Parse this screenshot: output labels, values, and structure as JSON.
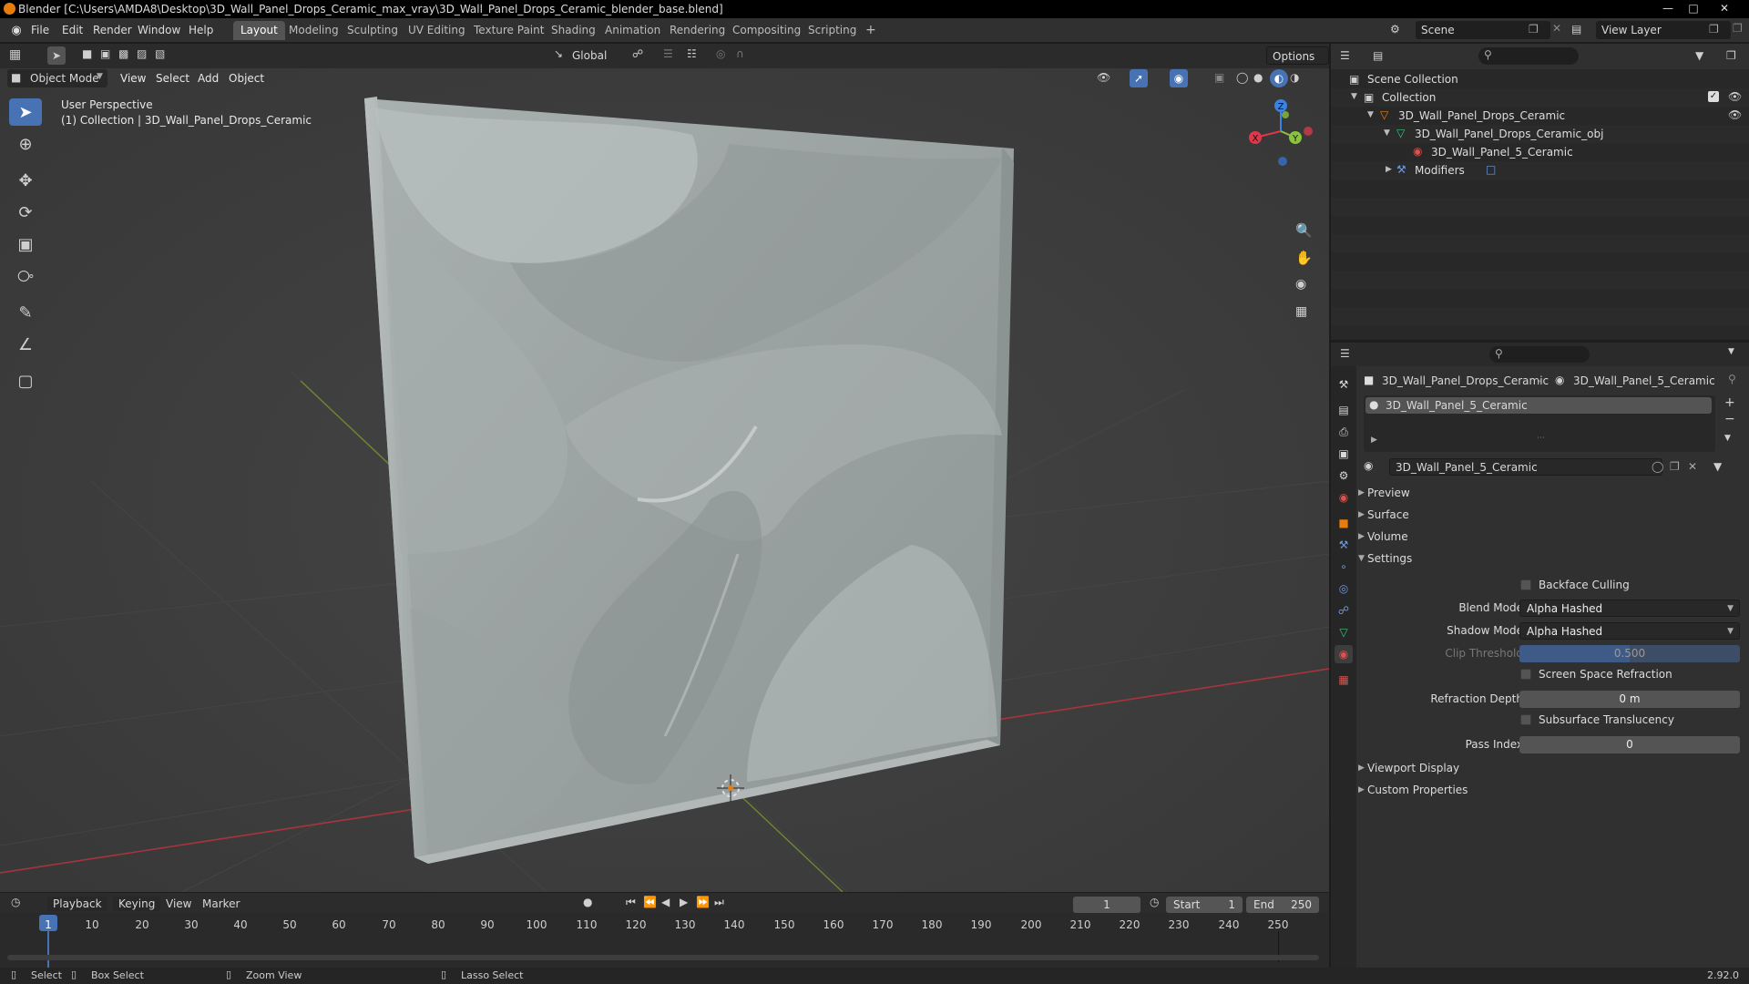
{
  "window": {
    "title": "Blender [C:\\Users\\AMDA8\\Desktop\\3D_Wall_Panel_Drops_Ceramic_max_vray\\3D_Wall_Panel_Drops_Ceramic_blender_base.blend]"
  },
  "menubar": {
    "items": [
      "File",
      "Edit",
      "Render",
      "Window",
      "Help"
    ],
    "workspaces": [
      "Layout",
      "Modeling",
      "Sculpting",
      "UV Editing",
      "Texture Paint",
      "Shading",
      "Animation",
      "Rendering",
      "Compositing",
      "Scripting"
    ],
    "active_workspace": "Layout",
    "add_tab": "+",
    "scene_label": "Scene",
    "view_layer_label": "View Layer"
  },
  "viewport": {
    "transform_orientation": "Global",
    "options_label": "Options",
    "mode": "Object Mode",
    "menus": [
      "View",
      "Select",
      "Add",
      "Object"
    ],
    "overlay_title": "User Perspective",
    "overlay_subtitle": "(1) Collection | 3D_Wall_Panel_Drops_Ceramic",
    "gizmo_axes": {
      "x": "X",
      "y": "Y",
      "z": "Z"
    }
  },
  "timeline": {
    "menus": [
      "Playback",
      "Keying",
      "View",
      "Marker"
    ],
    "current_frame": "1",
    "start_label": "Start",
    "start_value": "1",
    "end_label": "End",
    "end_value": "250",
    "ticks": [
      "1",
      "10",
      "20",
      "30",
      "40",
      "50",
      "60",
      "70",
      "80",
      "90",
      "100",
      "110",
      "120",
      "130",
      "140",
      "150",
      "160",
      "170",
      "180",
      "190",
      "200",
      "210",
      "220",
      "230",
      "240",
      "250"
    ]
  },
  "statusbar": {
    "select": "Select",
    "box_select": "Box Select",
    "zoom_view": "Zoom View",
    "lasso_select": "Lasso Select",
    "version": "2.92.0"
  },
  "outliner": {
    "scene_collection": "Scene Collection",
    "collection": "Collection",
    "object": "3D_Wall_Panel_Drops_Ceramic",
    "mesh": "3D_Wall_Panel_Drops_Ceramic_obj",
    "material": "3D_Wall_Panel_5_Ceramic",
    "modifiers": "Modifiers"
  },
  "properties": {
    "breadcrumb_object": "3D_Wall_Panel_Drops_Ceramic",
    "breadcrumb_material": "3D_Wall_Panel_5_Ceramic",
    "slot_name": "3D_Wall_Panel_5_Ceramic",
    "material_name": "3D_Wall_Panel_5_Ceramic",
    "panels": {
      "preview": "Preview",
      "surface": "Surface",
      "volume": "Volume",
      "settings": "Settings",
      "viewport_display": "Viewport Display",
      "custom_properties": "Custom Properties"
    },
    "settings": {
      "backface_culling": "Backface Culling",
      "blend_mode_label": "Blend Mode",
      "blend_mode_value": "Alpha Hashed",
      "shadow_mode_label": "Shadow Mode",
      "shadow_mode_value": "Alpha Hashed",
      "clip_threshold_label": "Clip Threshold",
      "clip_threshold_value": "0.500",
      "screen_space_refraction": "Screen Space Refraction",
      "refraction_depth_label": "Refraction Depth",
      "refraction_depth_value": "0 m",
      "subsurface_translucency": "Subsurface Translucency",
      "pass_index_label": "Pass Index",
      "pass_index_value": "0"
    }
  },
  "colors": {
    "accent": "#4772b3",
    "axis_x": "#e2364a",
    "axis_y": "#8ac43c",
    "axis_z": "#3c82e2",
    "object_orange": "#e87d0d"
  }
}
